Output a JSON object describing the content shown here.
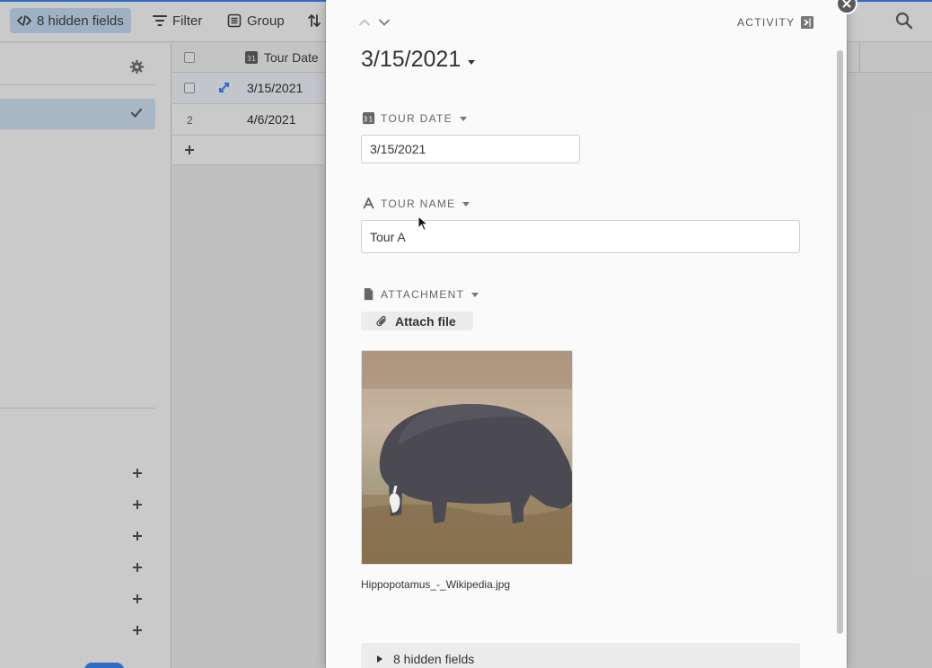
{
  "toolbar": {
    "hidden_fields_label": "8 hidden fields",
    "filter_label": "Filter",
    "group_label": "Group"
  },
  "grid": {
    "column_header": "Tour Date",
    "column_icon_text": "31",
    "rows": [
      {
        "number": "",
        "date": "3/15/2021"
      },
      {
        "number": "2",
        "date": "4/6/2021"
      }
    ]
  },
  "record": {
    "title": "3/15/2021",
    "activity_label": "ACTIVITY",
    "fields": {
      "tour_date": {
        "label": "TOUR DATE",
        "icon_text": "31",
        "value": "3/15/2021"
      },
      "tour_name": {
        "label": "TOUR NAME",
        "value": "Tour A"
      },
      "attachment": {
        "label": "ATTACHMENT",
        "button_label": "Attach file",
        "file_name": "Hippopotamus_-_Wikipedia.jpg"
      }
    },
    "hidden_fields_label": "8 hidden fields"
  },
  "colors": {
    "accent": "#2d7ff9",
    "selected_row": "#d2e5f7",
    "panel_bg": "#fafafa"
  }
}
